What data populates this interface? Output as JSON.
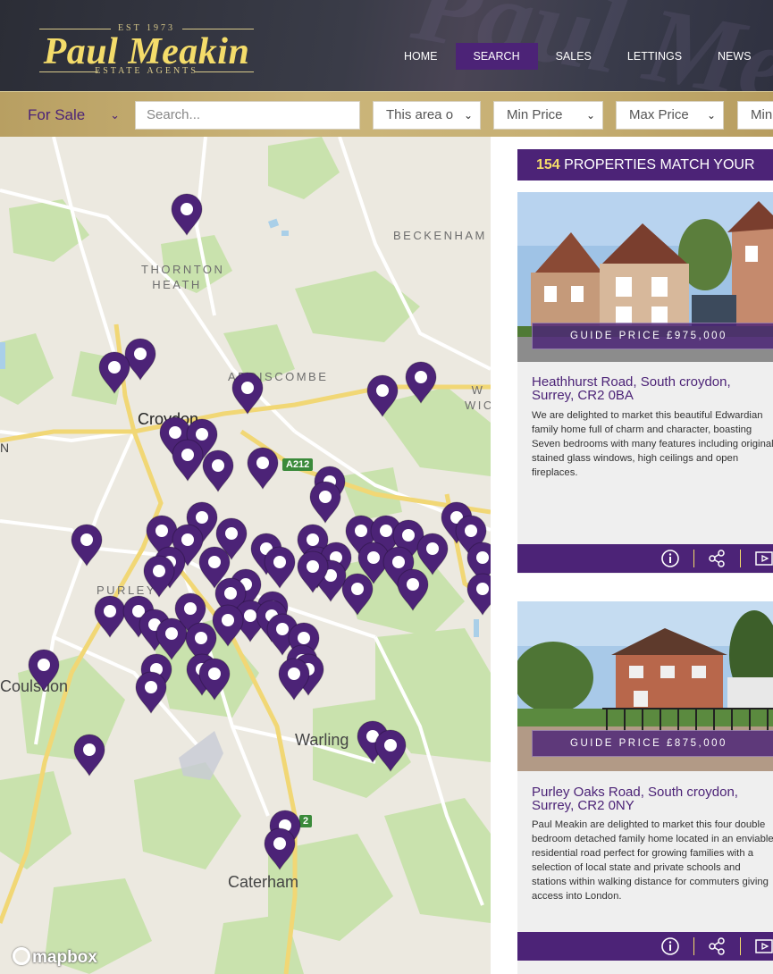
{
  "header": {
    "logo": {
      "est": "EST 1973",
      "name": "Paul Meakin",
      "sub": "ESTATE AGENTS"
    },
    "nav": [
      {
        "label": "HOME",
        "active": false
      },
      {
        "label": "SEARCH",
        "active": true
      },
      {
        "label": "SALES",
        "active": false
      },
      {
        "label": "LETTINGS",
        "active": false
      },
      {
        "label": "NEWS",
        "active": false
      }
    ]
  },
  "search": {
    "mode": "For Sale",
    "placeholder": "Search...",
    "area": "This area o",
    "min_price": "Min Price",
    "max_price": "Max Price",
    "min_beds": "Min"
  },
  "map": {
    "places": {
      "thornton_heath": "THORNTON\nHEATH",
      "beckenham": "BECKENHAM",
      "addiscombe": "ADDISCOMBE",
      "croydon": "Croydon",
      "purley": "PURLEY",
      "coulsdon": "Coulsdon",
      "warlingham": "Warling",
      "caterham": "Caterham",
      "wick": "W\nWIC",
      "n": "N"
    },
    "road_badges": {
      "a212": "A212",
      "a22": "2"
    },
    "attribution": "mapbox",
    "pin_color": "#4c2377"
  },
  "results": {
    "count": "154",
    "count_text": " PROPERTIES MATCH YOUR",
    "cards": [
      {
        "guide_price": "GUIDE PRICE £975,000",
        "title": "Heathhurst Road, South croydon, Surrey, CR2 0BA",
        "description": "We are delighted to market this beautiful Edwardian family home full of charm and character, boasting Seven bedrooms with many features including original stained glass windows, high ceilings and open fireplaces."
      },
      {
        "guide_price": "GUIDE PRICE £875,000",
        "title": "Purley Oaks Road, South croydon, Surrey, CR2 0NY",
        "description": "Paul Meakin are delighted to market this four double bedroom detached family home located in an enviable residential road perfect for growing families with a selection of local state and private schools and stations within walking distance for commuters giving access into London."
      }
    ]
  },
  "colors": {
    "brand_purple": "#4c2377",
    "brand_gold": "#f4dc6a"
  }
}
